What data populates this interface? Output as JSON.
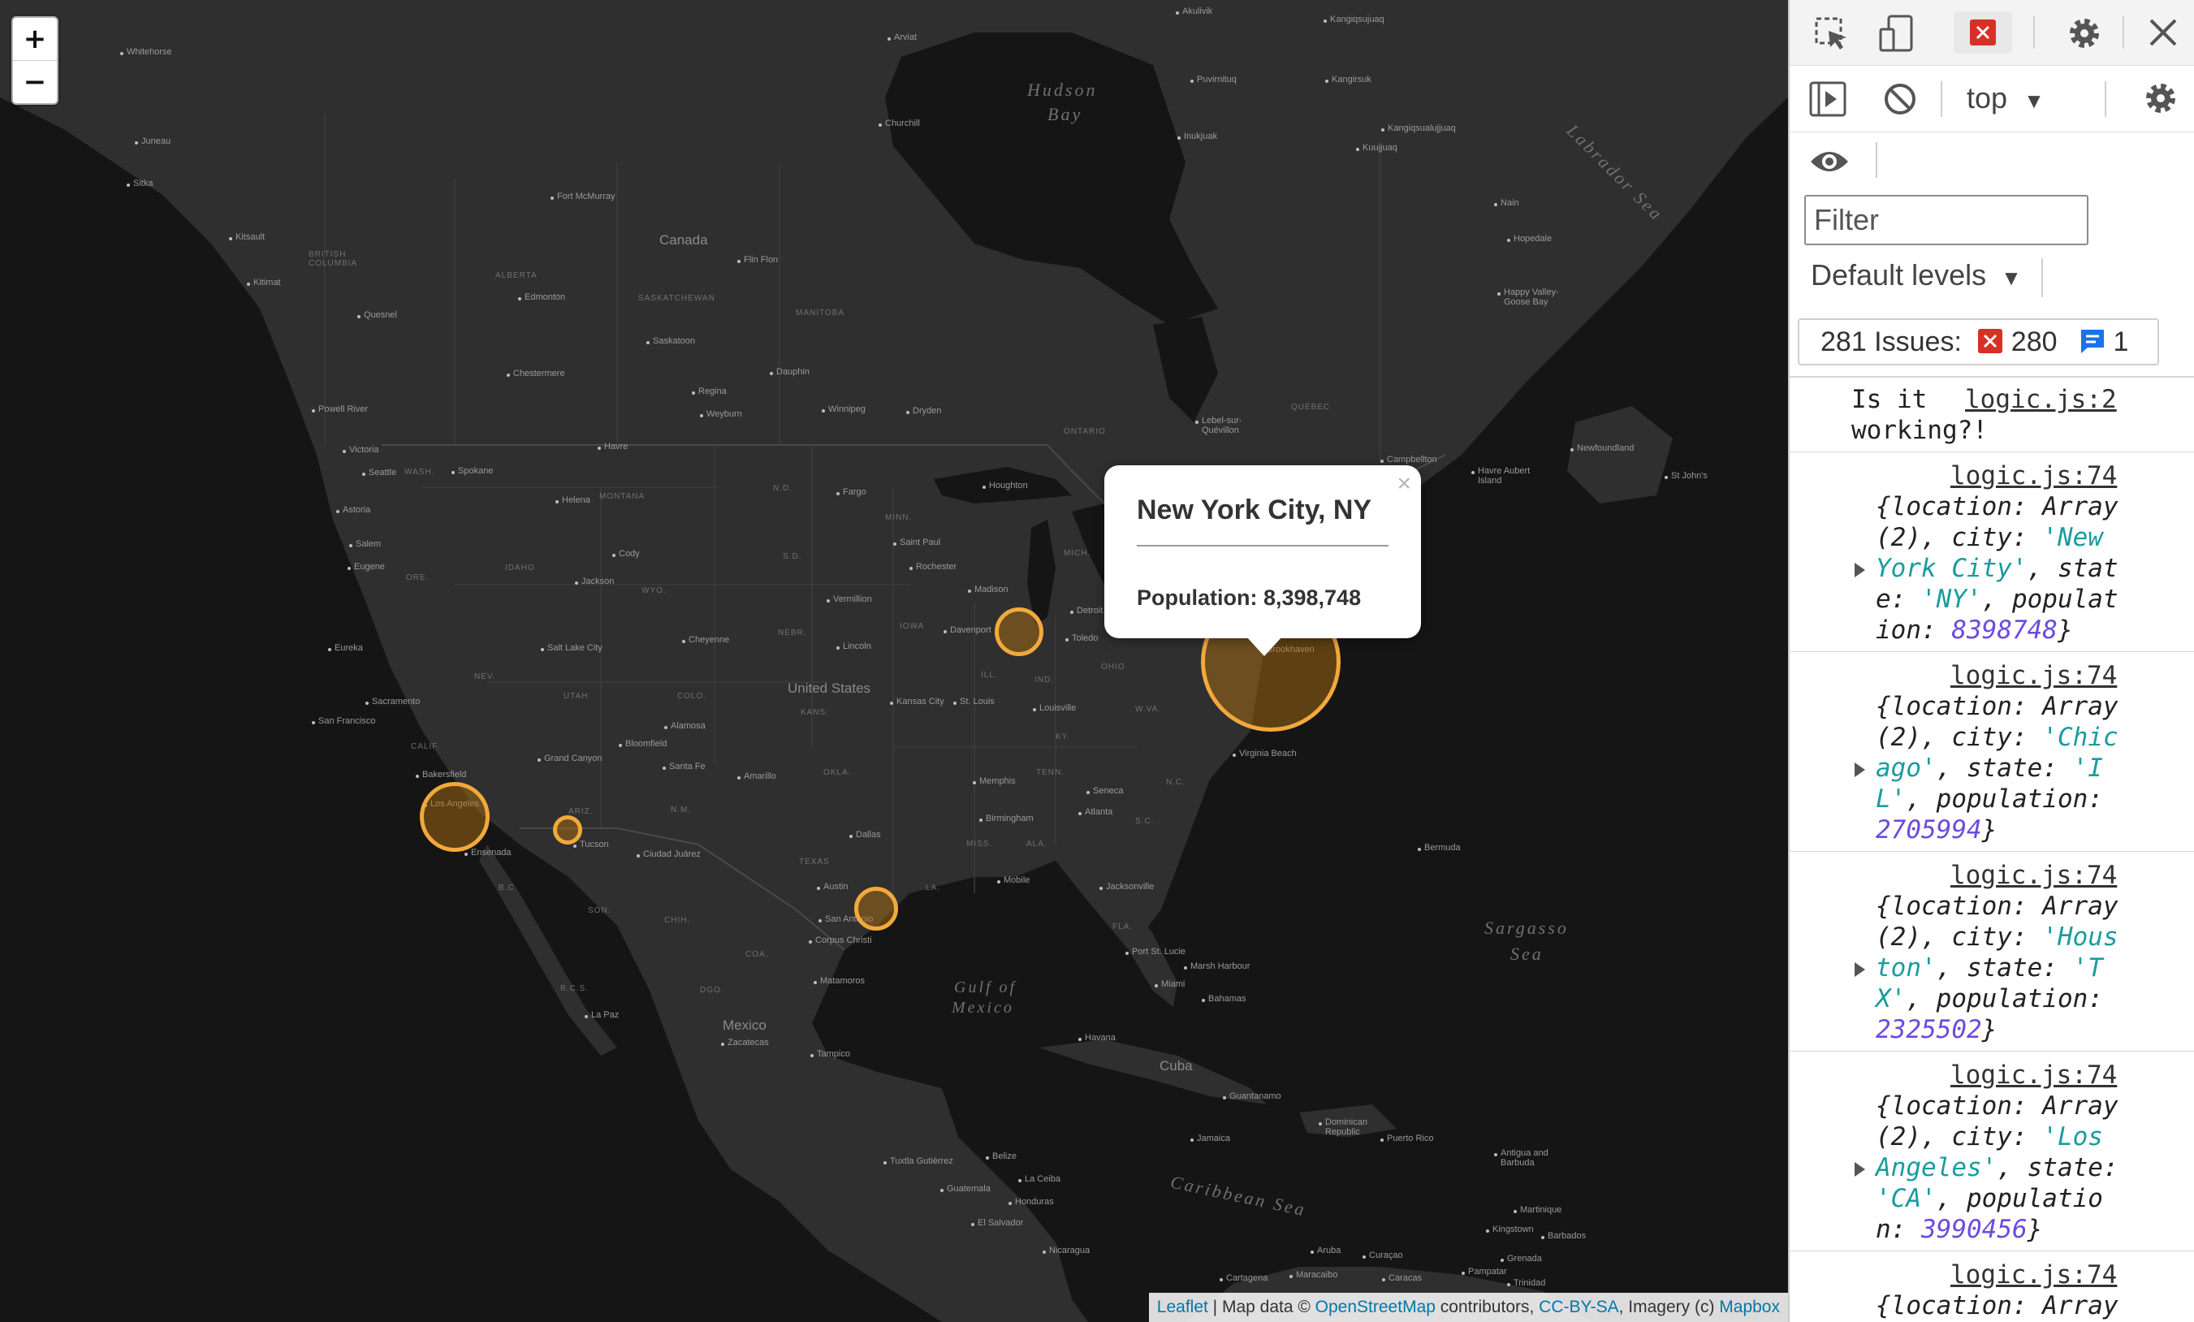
{
  "map": {
    "zoom_in_label": "+",
    "zoom_out_label": "−",
    "popup": {
      "close_label": "×",
      "title": "New York City, NY",
      "population_text": "Population: 8,398,748"
    },
    "attribution": {
      "leaflet": "Leaflet",
      "sep1": " | Map data © ",
      "osm": "OpenStreetMap",
      "sep2": " contributors, ",
      "license": "CC-BY-SA",
      "sep3": ", Imagery (c) ",
      "mapbox": "Mapbox"
    },
    "marker_color": "#f2a93b",
    "water_labels": {
      "hudson_bay_1": "Hudson",
      "hudson_bay_2": "Bay",
      "labrador_sea": "Labrador Sea",
      "gulf_1": "Gulf of",
      "gulf_2": "Mexico",
      "sargasso_1": "Sargasso",
      "sargasso_2": "Sea",
      "caribbean": "Caribbean Sea"
    },
    "countries": {
      "canada": "Canada",
      "united_states": "United States",
      "mexico": "Mexico",
      "cuba": "Cuba"
    },
    "regions": {
      "bc": "BRITISH\nCOLUMBIA",
      "alberta": "ALBERTA",
      "saskatchewan": "SASKATCHEWAN",
      "manitoba": "MANITOBA",
      "ontario": "ONTARIO",
      "quebec": "QUÉBEC",
      "montana": "MONTANA",
      "idaho": "IDAHO",
      "wyo": "WYO.",
      "nebr": "NEBR.",
      "iowa": "IOWA",
      "kans": "KANS.",
      "okla": "OKLA.",
      "texas": "TEXAS",
      "calif": "CALIF.",
      "nev": "NEV.",
      "utah": "UTAH",
      "colo": "COLO.",
      "ariz": "ARIZ.",
      "nm": "N.M.",
      "ore": "ORE.",
      "wash": "WASH.",
      "ill": "ILL.",
      "ind": "IND.",
      "ohio": "OHIO",
      "tenn": "TENN.",
      "ky": "KY.",
      "miss": "MISS.",
      "ala": "ALA.",
      "la": "LA.",
      "fla": "FLA.",
      "sc": "S.C.",
      "nc": "N.C.",
      "va": "W.VA.",
      "mich": "MICH.",
      "minn": "MINN.",
      "nd": "N.D.",
      "sd": "S.D.",
      "son": "SON.",
      "chih": "CHIH.",
      "coa": "COA.",
      "dgo": "DGO.",
      "bc2": "B.C.",
      "bcs": "B.C.S."
    },
    "cities": {
      "whitehorse": "Whitehorse",
      "juneau": "Juneau",
      "sitka": "Sitka",
      "kitsault": "Kitsault",
      "kitimat": "Kitimat",
      "quesnel": "Quesnel",
      "fort_mcmurray": "Fort McMurray",
      "edmonton": "Edmonton",
      "flin_flon": "Flin Flon",
      "churchill": "Churchill",
      "arviat": "Arviat",
      "akulivik": "Akulivik",
      "puvirnituq": "Puvirnituq",
      "kangirsuk": "Kangirsuk",
      "inukjuak": "Inukjuak",
      "kuujjuaq": "Kuujjuaq",
      "kangiqsualujjuaq": "Kangiqsualujjuaq",
      "kangiqsujuaq": "Kangiqsujuaq",
      "nain": "Nain",
      "hopedale": "Hopedale",
      "happy_valley": "Happy Valley-\nGoose Bay",
      "chestermere": "Chestermere",
      "saskatoon": "Saskatoon",
      "dauphin": "Dauphin",
      "regina": "Regina",
      "weyburn": "Weyburn",
      "winnipeg": "Winnipeg",
      "dryden": "Dryden",
      "powell_river": "Powell River",
      "victoria": "Victoria",
      "seattle": "Seattle",
      "spokane": "Spokane",
      "havre": "Havre",
      "helena": "Helena",
      "fargo": "Fargo",
      "houghton": "Houghton",
      "lebel": "Lebel-sur-\nQuévillon",
      "campbellton": "Campbellton",
      "havre_aubert": "Havre Aubert\nIsland",
      "newfoundland": "Newfoundland",
      "st_johns": "St John's",
      "astoria": "Astoria",
      "salem": "Salem",
      "eugene": "Eugene",
      "cody": "Cody",
      "jackson": "Jackson",
      "saint_paul": "Saint Paul",
      "rochester": "Rochester",
      "vermillion": "Vermillion",
      "madison": "Madison",
      "davenport": "Davenport",
      "detroit": "Detroit",
      "toledo": "Toledo",
      "eureka": "Eureka",
      "salt_lake": "Salt Lake City",
      "cheyenne": "Cheyenne",
      "lincoln": "Lincoln",
      "sacramento": "Sacramento",
      "san_francisco": "San Francisco",
      "kansas_city": "Kansas City",
      "st_louis": "St. Louis",
      "louisville": "Louisville",
      "virginia_beach": "Virginia Beach",
      "alamosa": "Alamosa",
      "bloomfield": "Bloomfield",
      "grand_canyon": "Grand Canyon",
      "santa_fe": "Santa Fe",
      "amarillo": "Amarillo",
      "memphis": "Memphis",
      "seneca": "Seneca",
      "atlanta": "Atlanta",
      "birmingham": "Birmingham",
      "bakersfield": "Bakersfield",
      "los_angeles": "Los Angeles",
      "ensenada": "Ensenada",
      "tucson": "Tucson",
      "ciudad_juarez": "Ciudad Juárez",
      "dallas": "Dallas",
      "austin": "Austin",
      "san_antonio": "San Antonio",
      "corpus_christi": "Corpus Christi",
      "mobile": "Mobile",
      "jacksonville": "Jacksonville",
      "port_st_lucie": "Port St. Lucie",
      "marsh_harbour": "Marsh Harbour",
      "miami": "Miami",
      "bahamas": "Bahamas",
      "bermuda": "Bermuda",
      "matamoros": "Matamoros",
      "la_paz": "La Paz",
      "zacatecas": "Zacatecas",
      "tampico": "Tampico",
      "havana": "Havana",
      "guantanamo": "Guantanamo",
      "dominican": "Dominican\nRepublic",
      "puerto_rico": "Puerto Rico",
      "jamaica": "Jamaica",
      "antigua": "Antigua and\nBarbuda",
      "martinique": "Martinique",
      "barbados": "Barbados",
      "kingstown": "Kingstown",
      "grenada": "Grenada",
      "trinidad": "Trinidad",
      "tuxtla": "Tuxtla Gutiérrez",
      "belize": "Belize",
      "la_ceiba": "La Ceiba",
      "guatemala": "Guatemala",
      "honduras": "Honduras",
      "el_salvador": "El Salvador",
      "nicaragua": "Nicaragua",
      "cartagena": "Cartagena",
      "maracaibo": "Maracaibo",
      "caracas": "Caracas",
      "pampatar": "Pampatar",
      "aruba": "Aruba",
      "curacao": "Curaçao",
      "brookhaven": "Brookhaven"
    }
  },
  "devtools": {
    "context_label": "top",
    "filter_placeholder": "Filter",
    "levels_label": "Default levels",
    "issues": {
      "label": "281 Issues:",
      "errors": "280",
      "info": "1"
    },
    "colors": {
      "error": "#d93025",
      "info": "#1a73e8",
      "string": "#1a9c9e",
      "number": "#6b4bdf"
    },
    "logs": [
      {
        "message_1": "Is it",
        "source": "logic.js:2",
        "message_2": "working?!"
      },
      {
        "source": "logic.js:74",
        "lines": [
          [
            "{location: Array"
          ],
          [
            "(2), city: ",
            "'New"
          ],
          [
            "York City'",
            ", stat"
          ],
          [
            "e: ",
            "'NY'",
            ", populat"
          ],
          [
            "ion: ",
            "8398748",
            "}"
          ]
        ]
      },
      {
        "source": "logic.js:74",
        "lines": [
          [
            "{location: Array"
          ],
          [
            "(2), city: ",
            "'Chic"
          ],
          [
            "ago'",
            ", state: ",
            "'I"
          ],
          [
            "L'",
            ", population:"
          ],
          [
            "2705994",
            "}"
          ]
        ]
      },
      {
        "source": "logic.js:74",
        "lines": [
          [
            "{location: Array"
          ],
          [
            "(2), city: ",
            "'Hous"
          ],
          [
            "ton'",
            ", state: ",
            "'T"
          ],
          [
            "X'",
            ", population:"
          ],
          [
            "2325502",
            "}"
          ]
        ]
      },
      {
        "source": "logic.js:74",
        "lines": [
          [
            "{location: Array"
          ],
          [
            "(2), city: ",
            "'Los"
          ],
          [
            "Angeles'",
            ", state:"
          ],
          [
            "'CA'",
            ", populatio"
          ],
          [
            "n: ",
            "3990456",
            "}"
          ]
        ]
      },
      {
        "source": "logic.js:74",
        "lines": [
          [
            "{location: Array"
          ]
        ]
      }
    ]
  }
}
